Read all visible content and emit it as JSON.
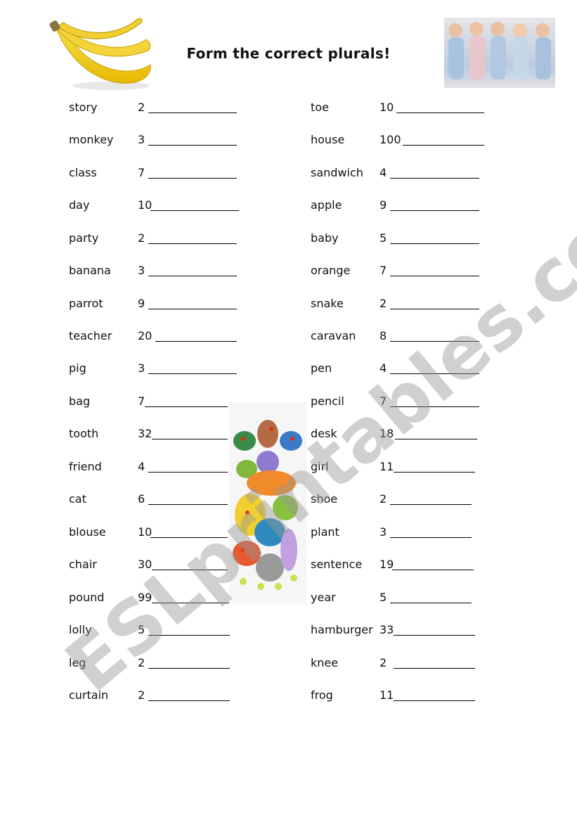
{
  "title": "Form the correct plurals!",
  "images": {
    "banana": "bananas",
    "babies": "row of babies",
    "frogs": "stack of colourful frogs"
  },
  "watermark": "ESLprintables.com",
  "left_column": [
    {
      "word": "story",
      "number": "2"
    },
    {
      "word": "monkey",
      "number": "3"
    },
    {
      "word": "class",
      "number": "7"
    },
    {
      "word": "day",
      "number": "10"
    },
    {
      "word": "party",
      "number": "2"
    },
    {
      "word": "banana",
      "number": "3"
    },
    {
      "word": "parrot",
      "number": "9"
    },
    {
      "word": "teacher",
      "number": "20"
    },
    {
      "word": "pig",
      "number": "3"
    },
    {
      "word": "bag",
      "number": "7"
    },
    {
      "word": "tooth",
      "number": "32"
    },
    {
      "word": "friend",
      "number": "4"
    },
    {
      "word": "cat",
      "number": "6"
    },
    {
      "word": "blouse",
      "number": "10"
    },
    {
      "word": "chair",
      "number": "30"
    },
    {
      "word": "pound",
      "number": "99"
    },
    {
      "word": "lolly",
      "number": "5"
    },
    {
      "word": "leg",
      "number": "2"
    },
    {
      "word": "curtain",
      "number": "2"
    }
  ],
  "right_column": [
    {
      "word": "toe",
      "number": "10"
    },
    {
      "word": "house",
      "number": "100"
    },
    {
      "word": "sandwich",
      "number": "4"
    },
    {
      "word": "apple",
      "number": "9"
    },
    {
      "word": "baby",
      "number": "5"
    },
    {
      "word": "orange",
      "number": "7"
    },
    {
      "word": "snake",
      "number": "2"
    },
    {
      "word": "caravan",
      "number": "8"
    },
    {
      "word": "pen",
      "number": "4"
    },
    {
      "word": "pencil",
      "number": "7"
    },
    {
      "word": "desk",
      "number": "18"
    },
    {
      "word": "girl",
      "number": "11"
    },
    {
      "word": "shoe",
      "number": "2"
    },
    {
      "word": "plant",
      "number": "3"
    },
    {
      "word": "sentence",
      "number": "19"
    },
    {
      "word": "year",
      "number": "5"
    },
    {
      "word": "hamburger",
      "number": "33"
    },
    {
      "word": "knee",
      "number": "2"
    },
    {
      "word": "frog",
      "number": "11"
    }
  ]
}
